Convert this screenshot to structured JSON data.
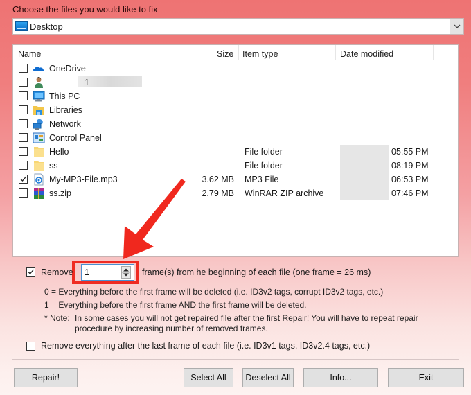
{
  "header": {
    "choose_label": "Choose the files you would like to fix"
  },
  "location": {
    "value": "Desktop",
    "icon": "desktop-icon"
  },
  "file_list": {
    "columns": [
      "Name",
      "Size",
      "Item type",
      "Date modified"
    ],
    "rows": [
      {
        "name": "OneDrive",
        "icon": "onedrive-cloud-icon",
        "checked": false,
        "size": "",
        "type": "",
        "time": ""
      },
      {
        "name": "1",
        "icon": "user-icon",
        "checked": false,
        "size": "",
        "type": "",
        "time": "",
        "name_blurred": true
      },
      {
        "name": "This PC",
        "icon": "this-pc-icon",
        "checked": false,
        "size": "",
        "type": "",
        "time": ""
      },
      {
        "name": "Libraries",
        "icon": "libraries-icon",
        "checked": false,
        "size": "",
        "type": "",
        "time": ""
      },
      {
        "name": "Network",
        "icon": "network-icon",
        "checked": false,
        "size": "",
        "type": "",
        "time": ""
      },
      {
        "name": "Control Panel",
        "icon": "control-panel-icon",
        "checked": false,
        "size": "",
        "type": "",
        "time": ""
      },
      {
        "name": "Hello",
        "icon": "folder-icon",
        "checked": false,
        "size": "",
        "type": "File folder",
        "time": "05:55 PM"
      },
      {
        "name": "ss",
        "icon": "folder-icon",
        "checked": false,
        "size": "",
        "type": "File folder",
        "time": "08:19 PM"
      },
      {
        "name": "My-MP3-File.mp3",
        "icon": "mp3-file-icon",
        "checked": true,
        "size": "3.62 MB",
        "type": "MP3 File",
        "time": "06:53 PM"
      },
      {
        "name": "ss.zip",
        "icon": "winrar-zip-icon",
        "checked": false,
        "size": "2.79 MB",
        "type": "WinRAR ZIP archive",
        "time": "07:46 PM"
      }
    ]
  },
  "options": {
    "remove_checked": true,
    "remove_label": "Remove",
    "frames_value": "1",
    "frames_label": "frame(s) from he beginning of each file (one frame = 26 ms)",
    "info0": "0 = Everything before the first frame will be deleted (i.e. ID3v2 tags, corrupt ID3v2 tags, etc.)",
    "info1": "1 = Everything before the first frame AND the first frame will be deleted.",
    "note_label": "* Note:",
    "note_text": "In some cases you will not get repaired file after the first Repair! You will have to repeat repair procedure by increasing number of removed frames.",
    "remove_after_checked": false,
    "remove_after_label": "Remove everything after the last frame of each file (i.e. ID3v1 tags, ID3v2.4 tags, etc.)"
  },
  "buttons": {
    "repair": "Repair!",
    "select_all": "Select All",
    "deselect_all": "Deselect All",
    "info": "Info...",
    "exit": "Exit"
  },
  "annotation": {
    "highlight_color": "#ef2b22",
    "arrow_color": "#f0281e"
  }
}
